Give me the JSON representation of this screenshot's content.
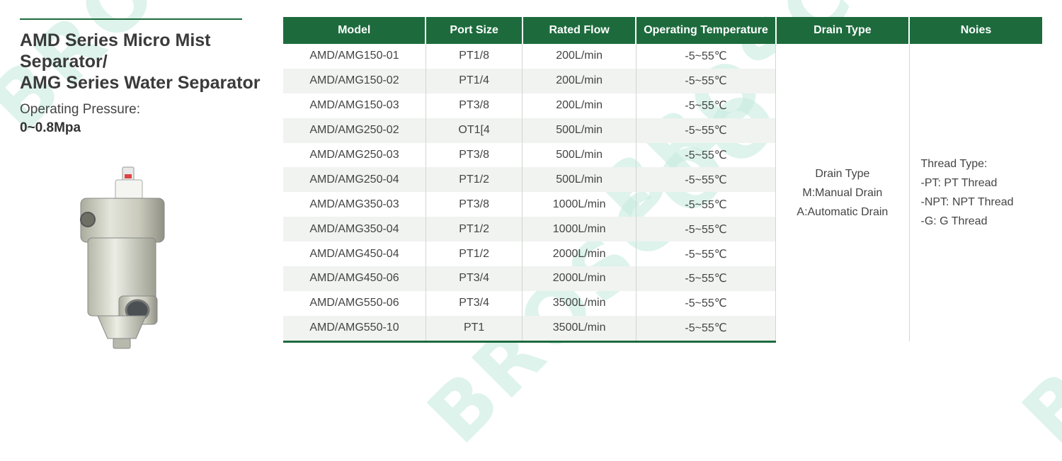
{
  "watermark": "BROSCOO",
  "product": {
    "title_line1": "AMD Series Micro Mist Separator/",
    "title_line2": "AMG Series Water Separator",
    "pressure_label": "Operating Pressure:",
    "pressure_value": "0~0.8Mpa"
  },
  "table": {
    "headers": {
      "model": "Model",
      "port": "Port Size",
      "flow": "Rated Flow",
      "temp": "Operating Temperature",
      "drain": "Drain Type",
      "notes": "Noies"
    },
    "rows": [
      {
        "model": "AMD/AMG150-01",
        "port": "PT1/8",
        "flow": "200L/min",
        "temp": "-5~55℃"
      },
      {
        "model": "AMD/AMG150-02",
        "port": "PT1/4",
        "flow": "200L/min",
        "temp": "-5~55℃"
      },
      {
        "model": "AMD/AMG150-03",
        "port": "PT3/8",
        "flow": "200L/min",
        "temp": "-5~55℃"
      },
      {
        "model": "AMD/AMG250-02",
        "port": "OT1[4",
        "flow": "500L/min",
        "temp": "-5~55℃"
      },
      {
        "model": "AMD/AMG250-03",
        "port": "PT3/8",
        "flow": "500L/min",
        "temp": "-5~55℃"
      },
      {
        "model": "AMD/AMG250-04",
        "port": "PT1/2",
        "flow": "500L/min",
        "temp": "-5~55℃"
      },
      {
        "model": "AMD/AMG350-03",
        "port": "PT3/8",
        "flow": "1000L/min",
        "temp": "-5~55℃"
      },
      {
        "model": "AMD/AMG350-04",
        "port": "PT1/2",
        "flow": "1000L/min",
        "temp": "-5~55℃"
      },
      {
        "model": "AMD/AMG450-04",
        "port": "PT1/2",
        "flow": "2000L/min",
        "temp": "-5~55℃"
      },
      {
        "model": "AMD/AMG450-06",
        "port": "PT3/4",
        "flow": "2000L/min",
        "temp": "-5~55℃"
      },
      {
        "model": "AMD/AMG550-06",
        "port": "PT3/4",
        "flow": "3500L/min",
        "temp": "-5~55℃"
      },
      {
        "model": "AMD/AMG550-10",
        "port": "PT1",
        "flow": "3500L/min",
        "temp": "-5~55℃"
      }
    ],
    "drain_type": {
      "line1": "Drain Type",
      "line2": "M:Manual Drain",
      "line3": "A:Automatic Drain"
    },
    "notes": {
      "line1": "Thread Type:",
      "line2": "-PT: PT Thread",
      "line3": "-NPT: NPT Thread",
      "line4": "-G: G Thread"
    }
  },
  "colors": {
    "header_green": "#1d6b3d",
    "row_stripe": "#f0f3f0",
    "watermark": "#c8ece0"
  }
}
